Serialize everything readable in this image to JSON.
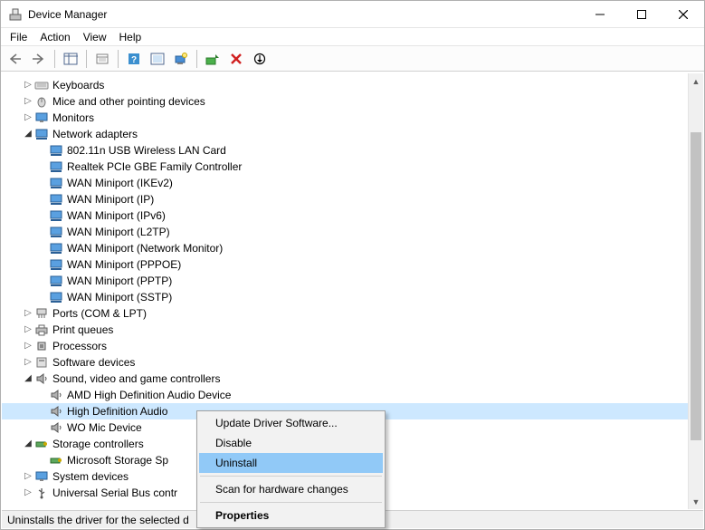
{
  "window": {
    "title": "Device Manager"
  },
  "menubar": {
    "file": "File",
    "action": "Action",
    "view": "View",
    "help": "Help"
  },
  "tree": {
    "keyboards": "Keyboards",
    "mice": "Mice and other pointing devices",
    "monitors": "Monitors",
    "network_adapters": "Network adapters",
    "net": {
      "i0": "802.11n USB Wireless LAN Card",
      "i1": "Realtek PCIe GBE Family Controller",
      "i2": "WAN Miniport (IKEv2)",
      "i3": "WAN Miniport (IP)",
      "i4": "WAN Miniport (IPv6)",
      "i5": "WAN Miniport (L2TP)",
      "i6": "WAN Miniport (Network Monitor)",
      "i7": "WAN Miniport (PPPOE)",
      "i8": "WAN Miniport (PPTP)",
      "i9": "WAN Miniport (SSTP)"
    },
    "ports": "Ports (COM & LPT)",
    "print_queues": "Print queues",
    "processors": "Processors",
    "software_devices": "Software devices",
    "sound": "Sound, video and game controllers",
    "snd": {
      "i0": "AMD High Definition Audio Device",
      "i1": "High Definition Audio",
      "i2": "WO Mic Device"
    },
    "storage_controllers": "Storage controllers",
    "stor": {
      "i0": "Microsoft Storage Sp"
    },
    "system_devices": "System devices",
    "usb_controllers": "Universal Serial Bus contr"
  },
  "context_menu": {
    "update": "Update Driver Software...",
    "disable": "Disable",
    "uninstall": "Uninstall",
    "scan": "Scan for hardware changes",
    "properties": "Properties"
  },
  "statusbar": {
    "text": "Uninstalls the driver for the selected d"
  }
}
